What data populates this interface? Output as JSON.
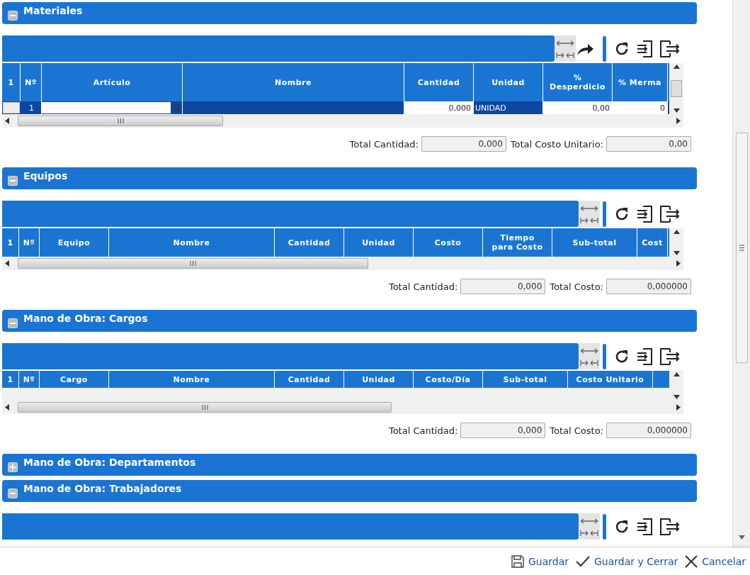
{
  "sections": [
    {
      "title": "Materiales",
      "expanded": true,
      "grid": {
        "tools": [
          {
            "kind": "fit"
          },
          {
            "kind": "share"
          },
          {
            "kind": "refresh"
          },
          {
            "kind": "import"
          },
          {
            "kind": "export"
          }
        ],
        "columns": [
          "1",
          "Nº",
          "Artículo",
          "Nombre",
          "Cantidad",
          "Unidad",
          "% Desperdicio",
          "% Merma"
        ],
        "rows": [
          {
            "selected": true,
            "cells": [
              {
                "kind": "check"
              },
              {
                "kind": "text",
                "value": "1"
              },
              {
                "kind": "lookup"
              },
              {
                "kind": "text"
              },
              {
                "kind": "input",
                "value": "0,000"
              },
              {
                "kind": "text",
                "value": "UNIDAD"
              },
              {
                "kind": "input",
                "value": "0,00"
              },
              {
                "kind": "input",
                "value": "0"
              }
            ]
          }
        ]
      },
      "totals": [
        {
          "label": "Total Cantidad:",
          "value": "0,000"
        },
        {
          "label": "Total Costo Unitario:",
          "value": "0,00"
        }
      ]
    },
    {
      "title": "Equipos",
      "expanded": true,
      "grid": {
        "tools": [
          {
            "kind": "fit"
          },
          {
            "kind": "refresh"
          },
          {
            "kind": "import"
          },
          {
            "kind": "export"
          }
        ],
        "columns": [
          "1",
          "Nº",
          "Equipo",
          "Nombre",
          "Cantidad",
          "Unidad",
          "Costo",
          "Tiempo para Costo",
          "Sub-total",
          "Cost"
        ]
      },
      "totals": [
        {
          "label": "Total Cantidad:",
          "value": "0,000"
        },
        {
          "label": "Total Costo:",
          "value": "0,000000"
        }
      ]
    },
    {
      "title": "Mano de Obra: Cargos",
      "expanded": true,
      "grid": {
        "tools": [
          {
            "kind": "fit"
          },
          {
            "kind": "refresh"
          },
          {
            "kind": "import"
          },
          {
            "kind": "export"
          }
        ],
        "columns": [
          "1",
          "Nº",
          "Cargo",
          "Nombre",
          "Cantidad",
          "Unidad",
          "Costo/Día",
          "Sub-total",
          "Costo Unitario"
        ]
      },
      "totals": [
        {
          "label": "Total Cantidad:",
          "value": "0,000"
        },
        {
          "label": "Total Costo:",
          "value": "0,000000"
        }
      ]
    },
    {
      "title": "Mano de Obra: Departamentos",
      "expanded": false
    },
    {
      "title": "Mano de Obra: Trabajadores",
      "expanded": true,
      "grid": {
        "tools": [
          {
            "kind": "fit"
          },
          {
            "kind": "refresh"
          },
          {
            "kind": "import"
          },
          {
            "kind": "export"
          }
        ]
      }
    }
  ],
  "footer": {
    "buttons": [
      {
        "kind": "save",
        "label": "Guardar"
      },
      {
        "kind": "check",
        "label": "Guardar y Cerrar"
      },
      {
        "kind": "cancel",
        "label": "Cancelar"
      }
    ]
  }
}
